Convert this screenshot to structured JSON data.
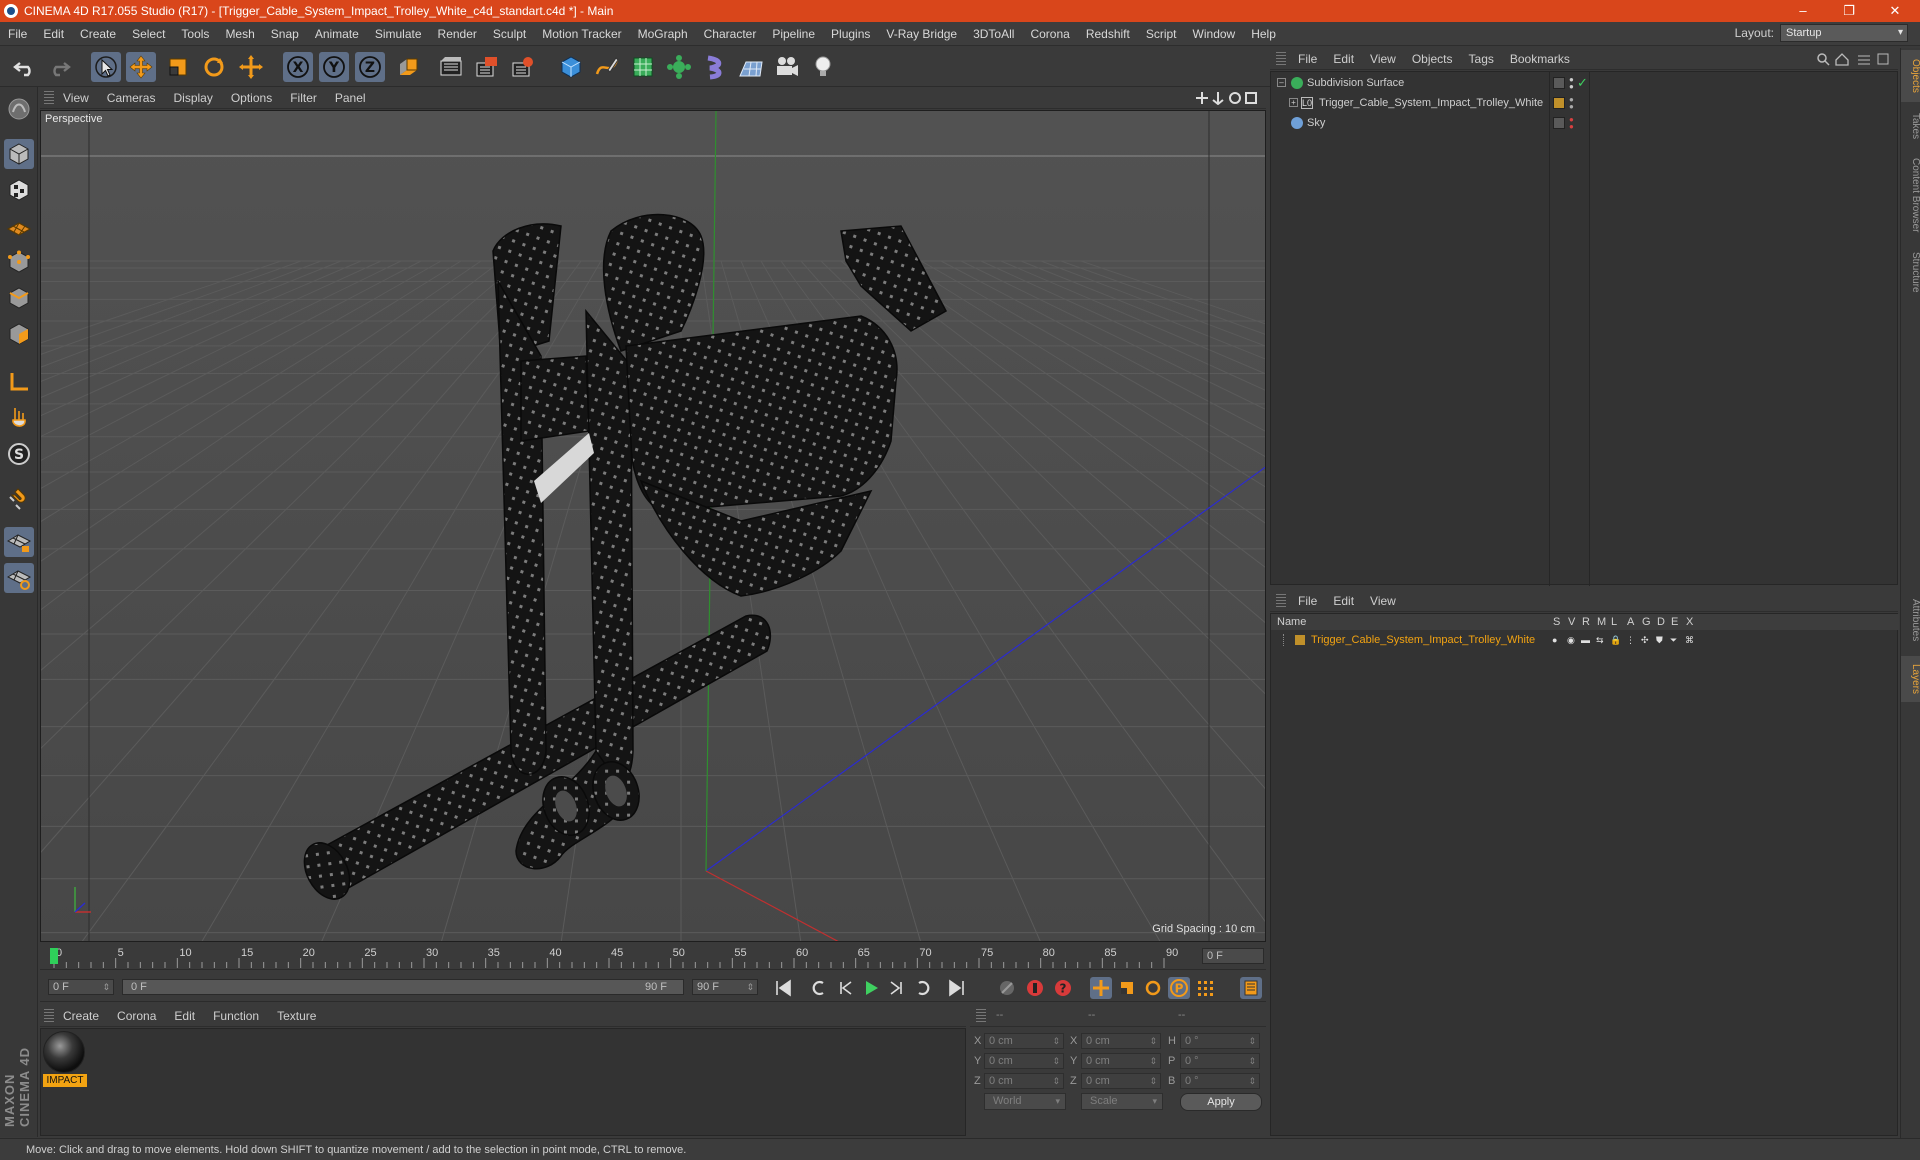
{
  "window": {
    "title": "CINEMA 4D R17.055 Studio (R17) - [Trigger_Cable_System_Impact_Trolley_White_c4d_standart.c4d *] - Main",
    "minimize": "–",
    "restore": "❐",
    "close": "✕"
  },
  "menubar": {
    "items": [
      "File",
      "Edit",
      "Create",
      "Select",
      "Tools",
      "Mesh",
      "Snap",
      "Animate",
      "Simulate",
      "Render",
      "Sculpt",
      "Motion Tracker",
      "MoGraph",
      "Character",
      "Pipeline",
      "Plugins",
      "V-Ray Bridge",
      "3DToAll",
      "Corona",
      "Redshift",
      "Script",
      "Window",
      "Help"
    ],
    "layout_label": "Layout:",
    "layout_value": "Startup"
  },
  "toolbar": {
    "icons": [
      "undo-icon",
      "redo-icon",
      "select-arrow-icon",
      "move-icon",
      "scale-icon",
      "rotate-icon",
      "transform-icon",
      "x-axis-icon",
      "y-axis-icon",
      "z-axis-icon",
      "coordinate-system-icon",
      "render-view-icon",
      "render-picture-viewer-icon",
      "edit-render-settings-icon",
      "cube-icon",
      "pen-spline-icon",
      "subdivision-icon",
      "array-icon",
      "deformer-icon",
      "floor-icon",
      "camera-icon",
      "light-icon"
    ],
    "axis_letters": [
      "X",
      "Y",
      "Z"
    ]
  },
  "left_tools": {
    "icons": [
      "make-editable-icon",
      "model-mode-icon",
      "texture-mode-icon",
      "workplane-icon",
      "points-mode-icon",
      "edges-mode-icon",
      "polygons-mode-icon",
      "axis-mode-icon",
      "tweak-mode-icon",
      "soft-selection-icon",
      "snap-magnet-icon",
      "locked-workplane-icon",
      "planar-workplane-icon"
    ],
    "snap_letter": "S"
  },
  "brand": "MAXON CINEMA 4D",
  "viewport": {
    "menu": [
      "View",
      "Cameras",
      "Display",
      "Options",
      "Filter",
      "Panel"
    ],
    "label": "Perspective",
    "grid_spacing": "Grid Spacing : 10 cm"
  },
  "timeline": {
    "ticks": [
      "0",
      "5",
      "10",
      "15",
      "20",
      "25",
      "30",
      "35",
      "40",
      "45",
      "50",
      "55",
      "60",
      "65",
      "70",
      "75",
      "80",
      "85",
      "90"
    ],
    "current_frame": "0 F",
    "start_frame": "0 F",
    "range_start": "0 F",
    "range_end": "90 F",
    "end_frame": "90 F"
  },
  "material_manager": {
    "menu": [
      "Create",
      "Corona",
      "Edit",
      "Function",
      "Texture"
    ],
    "materials": [
      {
        "name": "IMPACT"
      }
    ]
  },
  "coordinates": {
    "headers": [
      "--",
      "--",
      "--"
    ],
    "rows": [
      {
        "axis1": "X",
        "val1": "0 cm",
        "axis2": "X",
        "val2": "0 cm",
        "axis3": "H",
        "val3": "0 °"
      },
      {
        "axis1": "Y",
        "val1": "0 cm",
        "axis2": "Y",
        "val2": "0 cm",
        "axis3": "P",
        "val3": "0 °"
      },
      {
        "axis1": "Z",
        "val1": "0 cm",
        "axis2": "Z",
        "val2": "0 cm",
        "axis3": "B",
        "val3": "0 °"
      }
    ],
    "mode_world": "World",
    "mode_scale": "Scale",
    "apply": "Apply"
  },
  "object_manager": {
    "menu": [
      "File",
      "Edit",
      "View",
      "Objects",
      "Tags",
      "Bookmarks"
    ],
    "objects": [
      {
        "name": "Subdivision Surface",
        "indent": 0
      },
      {
        "name": "Trigger_Cable_System_Impact_Trolley_White",
        "indent": 1
      },
      {
        "name": "Sky",
        "indent": 0
      }
    ]
  },
  "layer_manager": {
    "menu": [
      "File",
      "Edit",
      "View"
    ],
    "columns": [
      "Name",
      "S",
      "V",
      "R",
      "M",
      "L",
      "A",
      "G",
      "D",
      "E",
      "X"
    ],
    "layers": [
      {
        "name": "Trigger_Cable_System_Impact_Trolley_White"
      }
    ]
  },
  "right_tabs": [
    "Objects",
    "Takes",
    "Content Browser",
    "Structure",
    "Attributes",
    "Layers"
  ],
  "status": "Move: Click and drag to move elements. Hold down SHIFT to quantize movement / add to the selection in point mode, CTRL to remove.",
  "colors": {
    "titlebar": "#d9461b",
    "accent_orange": "#f2a312",
    "active_button": "#5f6f88",
    "axis_green": "#3fa33f",
    "axis_blue": "#2b2bd0",
    "axis_red": "#c03030"
  }
}
